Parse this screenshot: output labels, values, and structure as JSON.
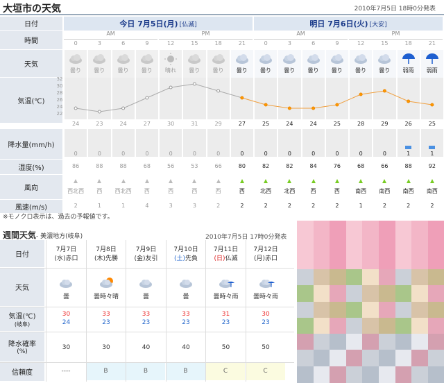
{
  "header": {
    "title": "大垣市の天気",
    "issued": "2010年7月5日 18時0分発表"
  },
  "hourly": {
    "row_labels": {
      "date": "日付",
      "time": "時間",
      "weather": "天気",
      "temp": "気温(℃)",
      "precip": "降水量(mm/h)",
      "humidity": "湿度(%)",
      "wind_dir": "風向",
      "wind_speed": "風速(m/s)"
    },
    "days": [
      {
        "label": "今日 7月5日(月)",
        "rokuyo": "[仏滅]"
      },
      {
        "label": "明日 7月6日(火)",
        "rokuyo": "[大安]"
      }
    ],
    "ampm": [
      "AM",
      "PM",
      "AM",
      "PM"
    ],
    "hours": [
      "0",
      "3",
      "6",
      "9",
      "12",
      "15",
      "18",
      "21",
      "0",
      "3",
      "6",
      "9",
      "12",
      "15",
      "18",
      "21"
    ],
    "weather": [
      "曇り",
      "曇り",
      "曇り",
      "曇り",
      "晴れ",
      "曇り",
      "曇り",
      "曇り",
      "曇り",
      "曇り",
      "曇り",
      "曇り",
      "曇り",
      "曇り",
      "弱雨",
      "弱雨"
    ],
    "weather_icons": [
      "cloud-icon",
      "cloud-icon",
      "cloud-icon",
      "cloud-icon",
      "sun-icon",
      "cloud-icon",
      "cloud-icon",
      "cloud-icon",
      "cloud-icon",
      "cloud-icon",
      "cloud-icon",
      "cloud-icon",
      "cloud-icon",
      "cloud-icon",
      "umbrella-icon",
      "umbrella-icon"
    ],
    "temp_axis": [
      "32",
      "30",
      "28",
      "26",
      "24",
      "22"
    ],
    "temps": [
      "24",
      "23",
      "24",
      "27",
      "30",
      "31",
      "29",
      "27",
      "25",
      "24",
      "24",
      "25",
      "28",
      "29",
      "26",
      "25"
    ],
    "precip": [
      "0",
      "0",
      "0",
      "0",
      "0",
      "0",
      "0",
      "0",
      "0",
      "0",
      "0",
      "0",
      "0",
      "0",
      "1",
      "1"
    ],
    "humidity": [
      "86",
      "88",
      "88",
      "68",
      "56",
      "53",
      "66",
      "80",
      "82",
      "82",
      "84",
      "76",
      "68",
      "66",
      "88",
      "92"
    ],
    "wind_dir": [
      "西北西",
      "西",
      "西北西",
      "西",
      "西",
      "西",
      "西",
      "西",
      "北西",
      "北西",
      "西",
      "西",
      "南西",
      "南西",
      "南西",
      "南西"
    ],
    "wind_speed": [
      "2",
      "1",
      "1",
      "4",
      "3",
      "3",
      "2",
      "2",
      "2",
      "2",
      "2",
      "2",
      "1",
      "2",
      "2",
      "2"
    ]
  },
  "note": "※モノクロ表示は、過去の予報値です。",
  "weekly": {
    "title": "週間天気",
    "region": "- 美濃地方(岐阜)",
    "issued": "2010年7月5日 17時0分発表",
    "row_labels": {
      "date": "日付",
      "weather": "天気",
      "temp": "気温(℃)",
      "temp_sub": "(岐阜)",
      "pop": "降水確率",
      "pop_sub": "(%)",
      "reliability": "信頼度"
    },
    "days": [
      {
        "date": "7月7日",
        "dow": "(水)",
        "rokuyo": "赤口",
        "weather": "曇",
        "icon": "cloud-icon",
        "high": "30",
        "low": "24",
        "pop": "30",
        "rel": "----"
      },
      {
        "date": "7月8日",
        "dow": "(木)",
        "rokuyo": "先勝",
        "weather": "曇時々晴",
        "icon": "cloud-sun-icon",
        "high": "33",
        "low": "23",
        "pop": "30",
        "rel": "B"
      },
      {
        "date": "7月9日",
        "dow": "(金)",
        "rokuyo": "友引",
        "weather": "曇",
        "icon": "cloud-icon",
        "high": "33",
        "low": "23",
        "pop": "40",
        "rel": "B"
      },
      {
        "date": "7月10日",
        "dow": "(土)",
        "rokuyo": "先負",
        "weather": "曇",
        "icon": "cloud-icon",
        "high": "33",
        "low": "23",
        "pop": "40",
        "rel": "B"
      },
      {
        "date": "7月11日",
        "dow": "(日)",
        "rokuyo": "仏滅",
        "weather": "曇時々雨",
        "icon": "cloud-rain-icon",
        "high": "31",
        "low": "23",
        "pop": "50",
        "rel": "C"
      },
      {
        "date": "7月12日",
        "dow": "(月)",
        "rokuyo": "赤口",
        "weather": "曇時々雨",
        "icon": "cloud-rain-icon",
        "high": "30",
        "low": "23",
        "pop": "50",
        "rel": "C"
      }
    ]
  },
  "colors": {
    "high": "#e33",
    "low": "#26c",
    "accent": "#1a3a8a",
    "sat": "#26c",
    "sun": "#d22",
    "wind": "#7c2"
  }
}
